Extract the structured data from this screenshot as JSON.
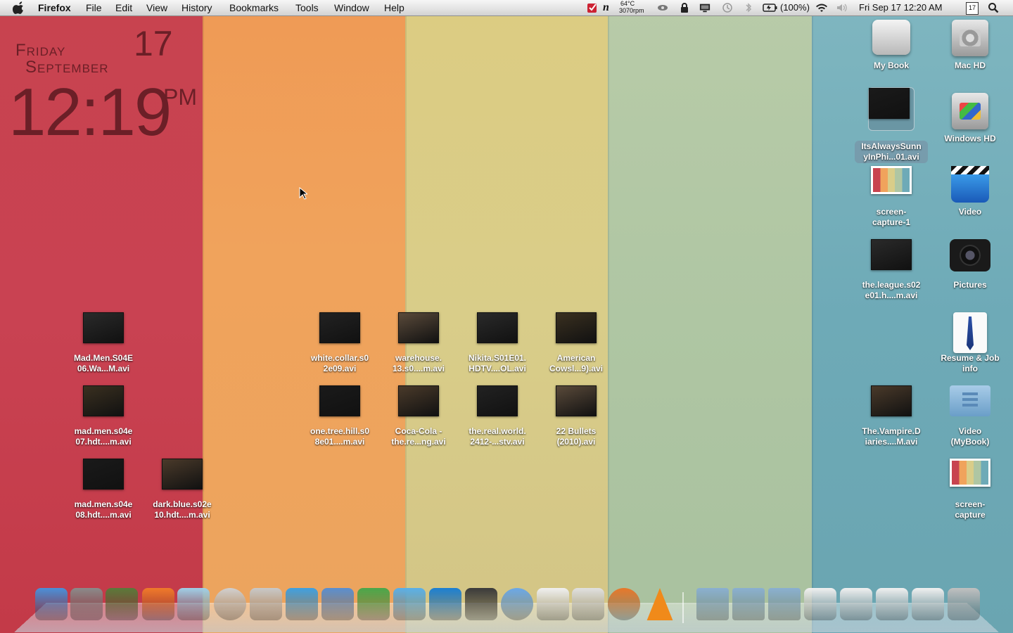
{
  "menubar": {
    "app_name": "Firefox",
    "menus": [
      "File",
      "Edit",
      "View",
      "History",
      "Bookmarks",
      "Tools",
      "Window",
      "Help"
    ],
    "temperature": "64°C",
    "fan_speed": "3070rpm",
    "battery": "(100%)",
    "datetime": "Fri Sep 17  12:20 AM",
    "calendar_day": "17"
  },
  "widget": {
    "day": "Friday",
    "date": "17",
    "month": "September",
    "time": "12:19",
    "ampm": "PM"
  },
  "desktop_icons": [
    {
      "label": "My Book",
      "kind": "external-drive-icon"
    },
    {
      "label": "Mac HD",
      "kind": "hard-drive-icon"
    },
    {
      "label": "ItsAlwaysSunn\nyInPhi...01.avi",
      "kind": "video-thumbnail",
      "selected": true
    },
    {
      "label": "Windows HD",
      "kind": "windows-drive-icon"
    },
    {
      "label": "screen-\ncapture-1",
      "kind": "screenshot-thumbnail"
    },
    {
      "label": "Video",
      "kind": "clapperboard-icon"
    },
    {
      "label": "the.league.s02\ne01.h....m.avi",
      "kind": "video-thumbnail"
    },
    {
      "label": "Pictures",
      "kind": "camera-icon"
    },
    {
      "label": "Resume & Job\ninfo",
      "kind": "shirt-tie-icon"
    },
    {
      "label": "The.Vampire.D\niaries....M.avi",
      "kind": "video-thumbnail"
    },
    {
      "label": "Video\n(MyBook)",
      "kind": "folder-alias-icon"
    },
    {
      "label": "screen-\ncapture",
      "kind": "screenshot-thumbnail"
    },
    {
      "label": "Mad.Men.S04E\n06.Wa...M.avi",
      "kind": "video-thumbnail"
    },
    {
      "label": "mad.men.s04e\n07.hdt....m.avi",
      "kind": "video-thumbnail"
    },
    {
      "label": "mad.men.s04e\n08.hdt....m.avi",
      "kind": "video-thumbnail"
    },
    {
      "label": "dark.blue.s02e\n10.hdt....m.avi",
      "kind": "video-thumbnail"
    },
    {
      "label": "white.collar.s0\n2e09.avi",
      "kind": "video-thumbnail"
    },
    {
      "label": "warehouse.\n13.s0....m.avi",
      "kind": "video-thumbnail"
    },
    {
      "label": "Nikita.S01E01.\nHDTV....OL.avi",
      "kind": "video-thumbnail"
    },
    {
      "label": "American\nCowsl...9).avi",
      "kind": "video-thumbnail"
    },
    {
      "label": "one.tree.hill.s0\n8e01....m.avi",
      "kind": "video-thumbnail"
    },
    {
      "label": "Coca-Cola -\nthe.re...ng.avi",
      "kind": "video-thumbnail"
    },
    {
      "label": "the.real.world.\n2412-...stv.avi",
      "kind": "video-thumbnail"
    },
    {
      "label": "22 Bullets\n(2010).avi",
      "kind": "video-thumbnail"
    }
  ],
  "dock": [
    {
      "name": "finder-icon",
      "color": "#4a90d9"
    },
    {
      "name": "system-preferences-icon",
      "color": "#8a8a8a"
    },
    {
      "name": "raygun-icon",
      "color": "#5a7a3a"
    },
    {
      "name": "rss-icon",
      "color": "#f07a2a"
    },
    {
      "name": "flask-icon",
      "color": "#9fd0e8"
    },
    {
      "name": "dvd-icon",
      "color": "#d0d0d0"
    },
    {
      "name": "dvd-player-icon",
      "color": "#c8c8c8"
    },
    {
      "name": "twitter-bird-icon",
      "color": "#3fa0e0"
    },
    {
      "name": "delivery-truck-icon",
      "color": "#5a8fd0"
    },
    {
      "name": "green-person-icon",
      "color": "#4aa84a"
    },
    {
      "name": "word-processor-icon",
      "color": "#5ab0e8"
    },
    {
      "name": "photoshop-icon",
      "color": "#1b7fd2"
    },
    {
      "name": "steam-icon",
      "color": "#3a3a3a"
    },
    {
      "name": "itunes-icon",
      "color": "#6aa8e8"
    },
    {
      "name": "calendar-icon",
      "color": "#f0f0f0"
    },
    {
      "name": "gmail-icon",
      "color": "#e0e0e0"
    },
    {
      "name": "firefox-icon",
      "color": "#e8782a"
    },
    {
      "name": "vlc-icon",
      "color": "#f08a1a"
    },
    {
      "name": "applications-folder-icon",
      "color": "#8ab0d0"
    },
    {
      "name": "documents-folder-icon",
      "color": "#8ab0d0"
    },
    {
      "name": "downloads-folder-icon",
      "color": "#8ab0d0"
    },
    {
      "name": "minimized-window-icon",
      "color": "#f0f0f0"
    },
    {
      "name": "minimized-window-icon",
      "color": "#f0f0f0"
    },
    {
      "name": "minimized-firefox-window-icon",
      "color": "#f0f0f0"
    },
    {
      "name": "minimized-firefox-window-icon",
      "color": "#f0f0f0"
    },
    {
      "name": "trash-icon",
      "color": "#c0c0c0"
    }
  ]
}
